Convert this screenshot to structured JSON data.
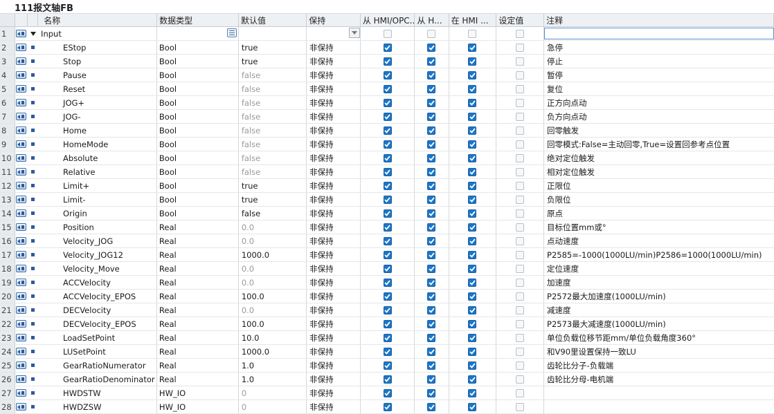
{
  "title": "111报文轴FB",
  "columns": {
    "name": "名称",
    "datatype": "数据类型",
    "default": "默认值",
    "retain": "保持",
    "hmi_opc": "从 HMI/OPC...",
    "hmi_h": "从 H...",
    "in_hmi": "在 HMI ...",
    "setpoint": "设定值",
    "comment": "注释"
  },
  "section": {
    "num": "1",
    "name": "Input"
  },
  "rows": [
    {
      "num": "2",
      "name": "EStop",
      "type": "Bool",
      "default": "true",
      "default_muted": false,
      "retain": "非保持",
      "hmi1": true,
      "hmi2": true,
      "hmi3": true,
      "set": false,
      "comment": "急停"
    },
    {
      "num": "3",
      "name": "Stop",
      "type": "Bool",
      "default": "true",
      "default_muted": false,
      "retain": "非保持",
      "hmi1": true,
      "hmi2": true,
      "hmi3": true,
      "set": false,
      "comment": "停止"
    },
    {
      "num": "4",
      "name": "Pause",
      "type": "Bool",
      "default": "false",
      "default_muted": true,
      "retain": "非保持",
      "hmi1": true,
      "hmi2": true,
      "hmi3": true,
      "set": false,
      "comment": "暂停"
    },
    {
      "num": "5",
      "name": "Reset",
      "type": "Bool",
      "default": "false",
      "default_muted": true,
      "retain": "非保持",
      "hmi1": true,
      "hmi2": true,
      "hmi3": true,
      "set": false,
      "comment": "复位"
    },
    {
      "num": "6",
      "name": "JOG+",
      "type": "Bool",
      "default": "false",
      "default_muted": true,
      "retain": "非保持",
      "hmi1": true,
      "hmi2": true,
      "hmi3": true,
      "set": false,
      "comment": "正方向点动"
    },
    {
      "num": "7",
      "name": "JOG-",
      "type": "Bool",
      "default": "false",
      "default_muted": true,
      "retain": "非保持",
      "hmi1": true,
      "hmi2": true,
      "hmi3": true,
      "set": false,
      "comment": "负方向点动"
    },
    {
      "num": "8",
      "name": "Home",
      "type": "Bool",
      "default": "false",
      "default_muted": true,
      "retain": "非保持",
      "hmi1": true,
      "hmi2": true,
      "hmi3": true,
      "set": false,
      "comment": "回零触发"
    },
    {
      "num": "9",
      "name": "HomeMode",
      "type": "Bool",
      "default": "false",
      "default_muted": true,
      "retain": "非保持",
      "hmi1": true,
      "hmi2": true,
      "hmi3": true,
      "set": false,
      "comment": "回零模式:False=主动回零,True=设置回参考点位置"
    },
    {
      "num": "10",
      "name": "Absolute",
      "type": "Bool",
      "default": "false",
      "default_muted": true,
      "retain": "非保持",
      "hmi1": true,
      "hmi2": true,
      "hmi3": true,
      "set": false,
      "comment": "绝对定位触发"
    },
    {
      "num": "11",
      "name": "Relative",
      "type": "Bool",
      "default": "false",
      "default_muted": true,
      "retain": "非保持",
      "hmi1": true,
      "hmi2": true,
      "hmi3": true,
      "set": false,
      "comment": "相对定位触发"
    },
    {
      "num": "12",
      "name": "Limit+",
      "type": "Bool",
      "default": "true",
      "default_muted": false,
      "retain": "非保持",
      "hmi1": true,
      "hmi2": true,
      "hmi3": true,
      "set": false,
      "comment": "正限位"
    },
    {
      "num": "13",
      "name": "Limit-",
      "type": "Bool",
      "default": "true",
      "default_muted": false,
      "retain": "非保持",
      "hmi1": true,
      "hmi2": true,
      "hmi3": true,
      "set": false,
      "comment": "负限位"
    },
    {
      "num": "14",
      "name": "Origin",
      "type": "Bool",
      "default": "false",
      "default_muted": false,
      "retain": "非保持",
      "hmi1": true,
      "hmi2": true,
      "hmi3": true,
      "set": false,
      "comment": "原点"
    },
    {
      "num": "15",
      "name": "Position",
      "type": "Real",
      "default": "0.0",
      "default_muted": true,
      "retain": "非保持",
      "hmi1": true,
      "hmi2": true,
      "hmi3": true,
      "set": false,
      "comment": "目标位置mm或°"
    },
    {
      "num": "16",
      "name": "Velocity_JOG",
      "type": "Real",
      "default": "0.0",
      "default_muted": true,
      "retain": "非保持",
      "hmi1": true,
      "hmi2": true,
      "hmi3": true,
      "set": false,
      "comment": "点动速度"
    },
    {
      "num": "17",
      "name": "Velocity_JOG12",
      "type": "Real",
      "default": "1000.0",
      "default_muted": false,
      "retain": "非保持",
      "hmi1": true,
      "hmi2": true,
      "hmi3": true,
      "set": false,
      "comment": "P2585=-1000(1000LU/min)P2586=1000(1000LU/min)"
    },
    {
      "num": "18",
      "name": "Velocity_Move",
      "type": "Real",
      "default": "0.0",
      "default_muted": true,
      "retain": "非保持",
      "hmi1": true,
      "hmi2": true,
      "hmi3": true,
      "set": false,
      "comment": "定位速度"
    },
    {
      "num": "19",
      "name": "ACCVelocity",
      "type": "Real",
      "default": "0.0",
      "default_muted": true,
      "retain": "非保持",
      "hmi1": true,
      "hmi2": true,
      "hmi3": true,
      "set": false,
      "comment": "加速度"
    },
    {
      "num": "20",
      "name": "ACCVelocity_EPOS",
      "type": "Real",
      "default": "100.0",
      "default_muted": false,
      "retain": "非保持",
      "hmi1": true,
      "hmi2": true,
      "hmi3": true,
      "set": false,
      "comment": "P2572最大加速度(1000LU/min)"
    },
    {
      "num": "21",
      "name": "DECVelocity",
      "type": "Real",
      "default": "0.0",
      "default_muted": true,
      "retain": "非保持",
      "hmi1": true,
      "hmi2": true,
      "hmi3": true,
      "set": false,
      "comment": "减速度"
    },
    {
      "num": "22",
      "name": "DECVelocity_EPOS",
      "type": "Real",
      "default": "100.0",
      "default_muted": false,
      "retain": "非保持",
      "hmi1": true,
      "hmi2": true,
      "hmi3": true,
      "set": false,
      "comment": "P2573最大减速度(1000LU/min)"
    },
    {
      "num": "23",
      "name": "LoadSetPoint",
      "type": "Real",
      "default": "10.0",
      "default_muted": false,
      "retain": "非保持",
      "hmi1": true,
      "hmi2": true,
      "hmi3": true,
      "set": false,
      "comment": "单位负载位移节距mm/单位负载角度360°"
    },
    {
      "num": "24",
      "name": "LUSetPoint",
      "type": "Real",
      "default": "1000.0",
      "default_muted": false,
      "retain": "非保持",
      "hmi1": true,
      "hmi2": true,
      "hmi3": true,
      "set": false,
      "comment": "和V90里设置保持一致LU"
    },
    {
      "num": "25",
      "name": "GearRatioNumerator",
      "type": "Real",
      "default": "1.0",
      "default_muted": false,
      "retain": "非保持",
      "hmi1": true,
      "hmi2": true,
      "hmi3": true,
      "set": false,
      "comment": "齿轮比分子-负载端"
    },
    {
      "num": "26",
      "name": "GearRatioDenominator",
      "type": "Real",
      "default": "1.0",
      "default_muted": false,
      "retain": "非保持",
      "hmi1": true,
      "hmi2": true,
      "hmi3": true,
      "set": false,
      "comment": "齿轮比分母-电机端"
    },
    {
      "num": "27",
      "name": "HWDSTW",
      "type": "HW_IO",
      "default": "0",
      "default_muted": true,
      "retain": "非保持",
      "hmi1": true,
      "hmi2": true,
      "hmi3": true,
      "set": false,
      "comment": ""
    },
    {
      "num": "28",
      "name": "HWDZSW",
      "type": "HW_IO",
      "default": "0",
      "default_muted": true,
      "retain": "非保持",
      "hmi1": true,
      "hmi2": true,
      "hmi3": true,
      "set": false,
      "comment": ""
    }
  ],
  "colors": {
    "checkbox_on": "#1b76c8",
    "header_bg": "#eef1f4",
    "muted_text": "#9a9a9a",
    "icon_blue": "#2c5aa0"
  },
  "icons": {
    "interface": "interface-input-icon",
    "member": "member-square-icon",
    "expand": "collapse-triangle-icon",
    "browse": "browse-dots-icon",
    "dropdown": "dropdown-arrow-icon"
  }
}
